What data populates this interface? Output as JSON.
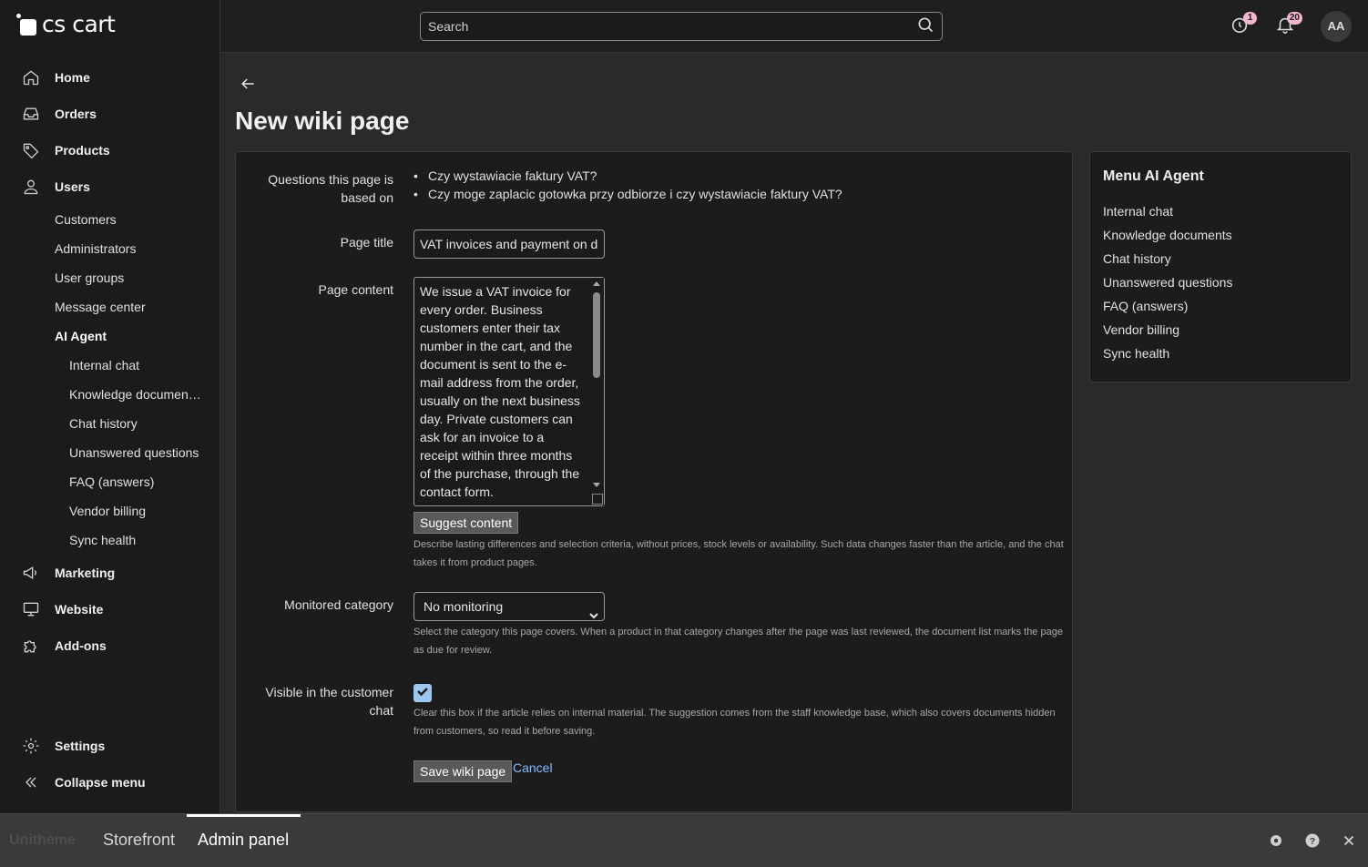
{
  "app": {
    "logo_text": "cs cart"
  },
  "topbar": {
    "search_placeholder": "Search",
    "help_badge": "1",
    "notifications_badge": "20",
    "avatar_initials": "AA"
  },
  "sidebar": {
    "items": [
      {
        "label": "Home",
        "icon": "home-icon"
      },
      {
        "label": "Orders",
        "icon": "inbox-icon"
      },
      {
        "label": "Products",
        "icon": "tag-icon"
      },
      {
        "label": "Users",
        "icon": "user-icon"
      }
    ],
    "users_sub": [
      "Customers",
      "Administrators",
      "User groups",
      "Message center",
      "AI Agent"
    ],
    "ai_agent_sub": [
      "Internal chat",
      "Knowledge documen…",
      "Chat history",
      "Unanswered questions",
      "FAQ (answers)",
      "Vendor billing",
      "Sync health"
    ],
    "items2": [
      {
        "label": "Marketing",
        "icon": "megaphone-icon"
      },
      {
        "label": "Website",
        "icon": "monitor-icon"
      },
      {
        "label": "Add-ons",
        "icon": "puzzle-icon"
      }
    ],
    "settings_label": "Settings",
    "collapse_label": "Collapse menu"
  },
  "page": {
    "title": "New wiki page",
    "questions_label": "Questions this page is based on",
    "questions": [
      "Czy wystawiacie faktury VAT?",
      "Czy moge zaplacic gotowka przy odbiorze i czy wystawiacie faktury VAT?"
    ],
    "page_title_label": "Page title",
    "page_title_value": "VAT invoices and payment on de",
    "page_content_label": "Page content",
    "page_content_value": "We issue a VAT invoice for every order. Business customers enter their tax number in the cart, and the document is sent to the e-mail address from the order, usually on the next business day. Private customers can ask for an invoice to a receipt within three months of the purchase, through the contact form.",
    "suggest_button": "Suggest content",
    "content_help": "Describe lasting differences and selection criteria, without prices, stock levels or availability. Such data changes faster than the article, and the chat takes it from product pages.",
    "category_label": "Monitored category",
    "category_value": "No monitoring",
    "category_help": "Select the category this page covers. When a product in that category changes after the page was last reviewed, the document list marks the page as due for review.",
    "visible_label": "Visible in the customer chat",
    "visible_checked": true,
    "visible_help": "Clear this box if the article relies on internal material. The suggestion comes from the staff knowledge base, which also covers documents hidden from customers, so read it before saving.",
    "save_button": "Save wiki page",
    "cancel_link": "Cancel"
  },
  "side_menu": {
    "title": "Menu AI Agent",
    "links": [
      "Internal chat",
      "Knowledge documents",
      "Chat history",
      "Unanswered questions",
      "FAQ (answers)",
      "Vendor billing",
      "Sync health"
    ]
  },
  "bottombar": {
    "brand": "Unitheme",
    "tabs": [
      "Storefront",
      "Admin panel"
    ],
    "active_tab": "Admin panel"
  },
  "colors": {
    "background": "#2a2a2a",
    "sidebar": "#1b1b1b",
    "card": "#1c1c1c",
    "badge": "#f5b4cf",
    "link": "#8ab8ff",
    "checkbox": "#9cc7ee"
  }
}
